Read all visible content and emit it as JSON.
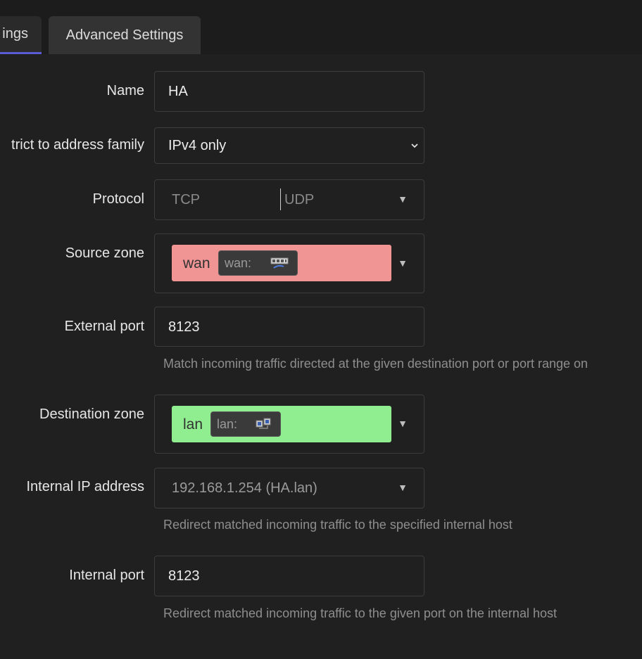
{
  "tabs": {
    "general": "ings",
    "advanced": "Advanced Settings"
  },
  "form": {
    "name": {
      "label": "Name",
      "value": "HA"
    },
    "family": {
      "label": "trict to address family",
      "value": "IPv4 only"
    },
    "protocol": {
      "label": "Protocol",
      "opt1": "TCP",
      "opt2": "UDP"
    },
    "source_zone": {
      "label": "Source zone",
      "zone": "wan",
      "iface": "wan:",
      "color": "#f09494"
    },
    "external_port": {
      "label": "External port",
      "value": "8123",
      "hint": "Match incoming traffic directed at the given destination port or port range on"
    },
    "dest_zone": {
      "label": "Destination zone",
      "zone": "lan",
      "iface": "lan:",
      "color": "#90ee90"
    },
    "internal_ip": {
      "label": "Internal IP address",
      "value": "192.168.1.254 (HA.lan)",
      "hint": "Redirect matched incoming traffic to the specified internal host"
    },
    "internal_port": {
      "label": "Internal port",
      "value": "8123",
      "hint": "Redirect matched incoming traffic to the given port on the internal host"
    }
  },
  "icons": {
    "dropdown": "triangle-down-icon",
    "select": "chevron-down-icon",
    "wan_iface": "network-ports-icon",
    "lan_iface": "bridge-icon"
  }
}
